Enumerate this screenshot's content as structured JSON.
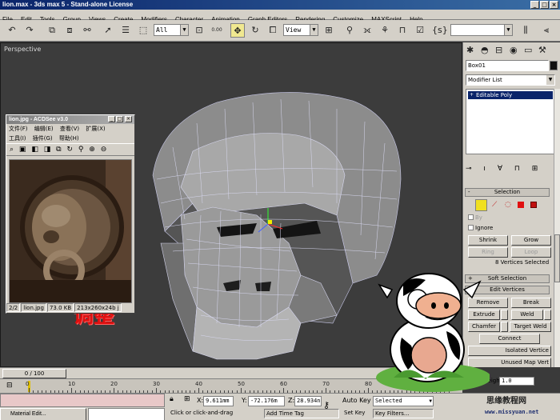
{
  "window": {
    "title": "lion.max - 3ds max 5 - Stand-alone License",
    "minimize": "_",
    "maximize": "□",
    "close": "×"
  },
  "menu": [
    "File",
    "Edit",
    "Tools",
    "Group",
    "Views",
    "Create",
    "Modifiers",
    "Character",
    "Animation",
    "Graph Editors",
    "Rendering",
    "Customize",
    "MAXScript",
    "Help"
  ],
  "toolbar": {
    "selection_filter": "All",
    "ref_coord": "View",
    "spinner_value": "0.00",
    "named_sel": ""
  },
  "viewport": {
    "label": "Perspective"
  },
  "overlay_text": "调整",
  "acdsee": {
    "title": "lion.jpg - ACDSee v3.0",
    "menu_row1": [
      "文件(F)",
      "编辑(E)",
      "查看(V)",
      "扩展(X)"
    ],
    "menu_row2": [
      "工具(I)",
      "插件(G)",
      "帮助(H)"
    ],
    "status": [
      "2/2",
      "lion.jpg",
      "73.0 KB",
      "213x260x24b j"
    ]
  },
  "command_panel": {
    "object_name": "Box01",
    "modifier_list": "Modifier List",
    "stack_item": "Editable Poly",
    "rollout_selection": "Selection",
    "by_vertex": "By",
    "ignore": "Ignore",
    "shrink": "Shrink",
    "grow": "Grow",
    "ring": "Ring",
    "loop": "Loop",
    "selection_info": "8 Vertices Selected",
    "rollout_soft": "Soft Selection",
    "rollout_edit_vertices": "Edit Vertices",
    "remove": "Remove",
    "break": "Break",
    "extrude": "Extrude",
    "weld": "Weld",
    "chamfer": "Chamfer",
    "target_weld": "Target Weld",
    "connect": "Connect",
    "remove_isolated": "Isolated Vertice",
    "remove_unused_map": "Unused Map Vert",
    "weight_label": "Weight:",
    "weight_value": "1.0",
    "plus": "+",
    "minus": "-"
  },
  "timeline": {
    "frame": "0 / 100",
    "ticks": [
      "0",
      "10",
      "20",
      "30",
      "40",
      "50",
      "60",
      "70",
      "80",
      "90",
      "100"
    ]
  },
  "status": {
    "task_button": "Material Edit...",
    "x_label": "X:",
    "x_value": "9.611mm",
    "y_label": "Y:",
    "y_value": "-72.176m",
    "z_label": "Z:",
    "z_value": "28.934n",
    "auto_key": "Auto Key",
    "selected": "Selected",
    "set_key": "Set Key",
    "key_filters": "Key Filters...",
    "prompt": "Click or click-and-drag",
    "add_time_tag": "Add Time Tag"
  },
  "watermark": {
    "line1": "思缘教程网",
    "line2": "www.missyuan.net"
  }
}
